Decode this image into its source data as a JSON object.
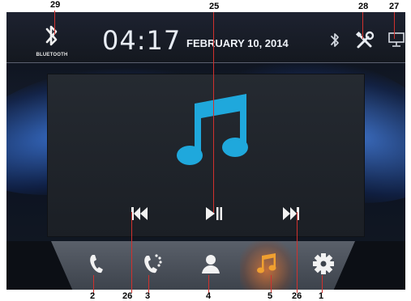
{
  "callouts": {
    "n29": "29",
    "n25": "25",
    "n28": "28",
    "n27": "27",
    "n2": "2",
    "n26a": "26",
    "n3": "3",
    "n4": "4",
    "n5": "5",
    "n26b": "26",
    "n1": "1"
  },
  "status_bar": {
    "bluetooth_label": "BLUETOOTH",
    "time": "04:17",
    "date": "FEBRUARY 10, 2014",
    "icons": [
      "bluetooth-icon",
      "settings-tools-icon",
      "display-icon"
    ]
  },
  "player": {
    "icon": "music-note-icon",
    "controls": [
      "previous-icon",
      "play-pause-icon",
      "next-icon"
    ]
  },
  "dock": {
    "items": [
      "phone-icon",
      "call-log-icon",
      "contacts-icon",
      "music-icon",
      "settings-gear-icon"
    ],
    "active": "music-icon"
  },
  "colors": {
    "accent_blue": "#1fa8dc",
    "active_orange": "#f0a030",
    "leader_red": "#d0312d"
  }
}
